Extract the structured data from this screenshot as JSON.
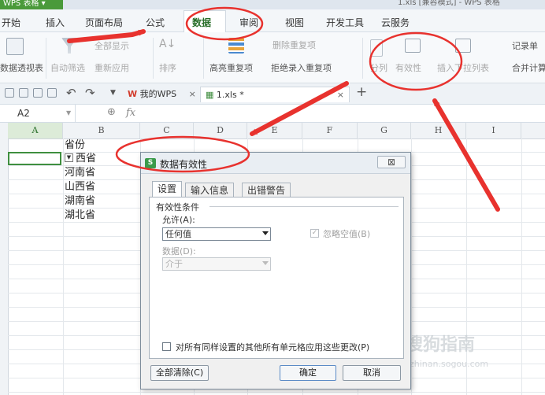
{
  "app": {
    "menu_button": "WPS 表格 ▾",
    "window_title": "1.xls  [兼容模式] - WPS 表格"
  },
  "menu_tabs": [
    "开始",
    "插入",
    "页面布局",
    "公式",
    "数据",
    "审阅",
    "视图",
    "开发工具",
    "云服务"
  ],
  "ribbon": {
    "pivot": "数据透视表",
    "auto_filter": "自动筛选",
    "show_all": "全部显示",
    "reapply": "重新应用",
    "sort": "排序",
    "highlight_dup": "高亮重复项",
    "remove_dup": "删除重复项",
    "reject_dup": "拒绝录入重复项",
    "split": "分列",
    "validation": "有效性",
    "insert_dropdown": "插入下拉列表",
    "record_form": "记录单",
    "merge_calc": "合并计算"
  },
  "doc_tabs": {
    "mywps": "我的WPS",
    "file": "1.xls *",
    "close": "×",
    "add": "+"
  },
  "formula_bar": {
    "name_box": "A2",
    "fx": "fx"
  },
  "columns": [
    "A",
    "B",
    "C",
    "D",
    "E",
    "F",
    "G",
    "H",
    "I"
  ],
  "cells": {
    "header": "省份",
    "rows": [
      "西省",
      "河南省",
      "山西省",
      "湖南省",
      "湖北省"
    ]
  },
  "dialog": {
    "title": "数据有效性",
    "close": "⊠",
    "tabs": [
      "设置",
      "输入信息",
      "出错警告"
    ],
    "section": "有效性条件",
    "allow_label": "允许(A):",
    "allow_value": "任何值",
    "data_label": "数据(D):",
    "data_value": "介于",
    "ignore_blank": "忽略空值(B)",
    "apply_all": "对所有同样设置的其他所有单元格应用这些更改(P)",
    "clear_all": "全部清除(C)",
    "ok": "确定",
    "cancel": "取消"
  },
  "watermark": {
    "brand": "搜狗指南",
    "url": "zhinan.sogou.com"
  },
  "colors": {
    "annotation_red": "#e8322e",
    "active_tab": "#2a6f2a",
    "selection": "#3f8f3f"
  }
}
